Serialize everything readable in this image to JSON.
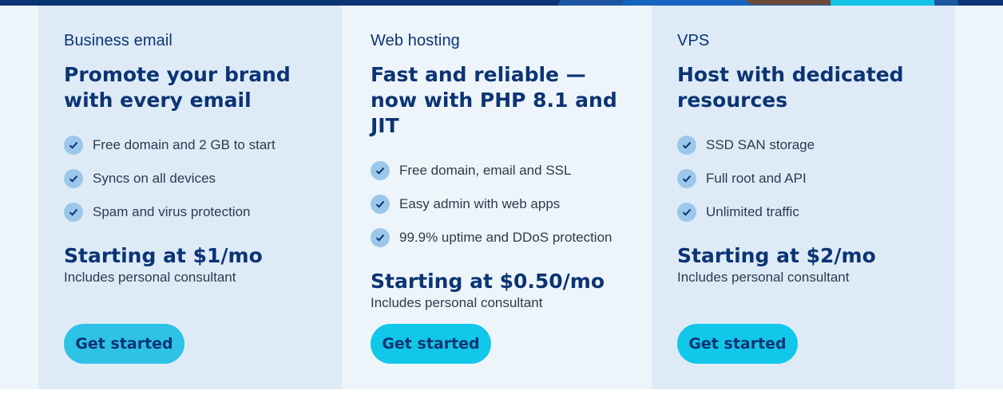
{
  "colors": {
    "navy": "#0b3474",
    "card_light": "#deebf7",
    "card_lighter": "#eef5fa",
    "button_cyan": "#11c7ea",
    "check_bg": "#9cc7ea"
  },
  "cards": [
    {
      "eyebrow": "Business email",
      "headline": "Promote your brand with every email",
      "features": [
        "Free domain and 2 GB to start",
        "Syncs on all devices",
        "Spam and virus protection"
      ],
      "price": "Starting at $1/mo",
      "sub": "Includes personal consultant",
      "button": "Get started"
    },
    {
      "eyebrow": "Web hosting",
      "headline": "Fast and reliable — now with PHP 8.1 and JIT",
      "features": [
        "Free domain, email and SSL",
        "Easy admin with web apps",
        "99.9% uptime and DDoS protection"
      ],
      "price": "Starting at $0.50/mo",
      "sub": "Includes personal consultant",
      "button": "Get started"
    },
    {
      "eyebrow": "VPS",
      "headline": "Host with dedicated resources",
      "features": [
        "SSD SAN storage",
        "Full root and API",
        "Unlimited traffic"
      ],
      "price": "Starting at $2/mo",
      "sub": "Includes personal consultant",
      "button": "Get started"
    }
  ],
  "icons": {
    "feature_check": "check-icon"
  }
}
